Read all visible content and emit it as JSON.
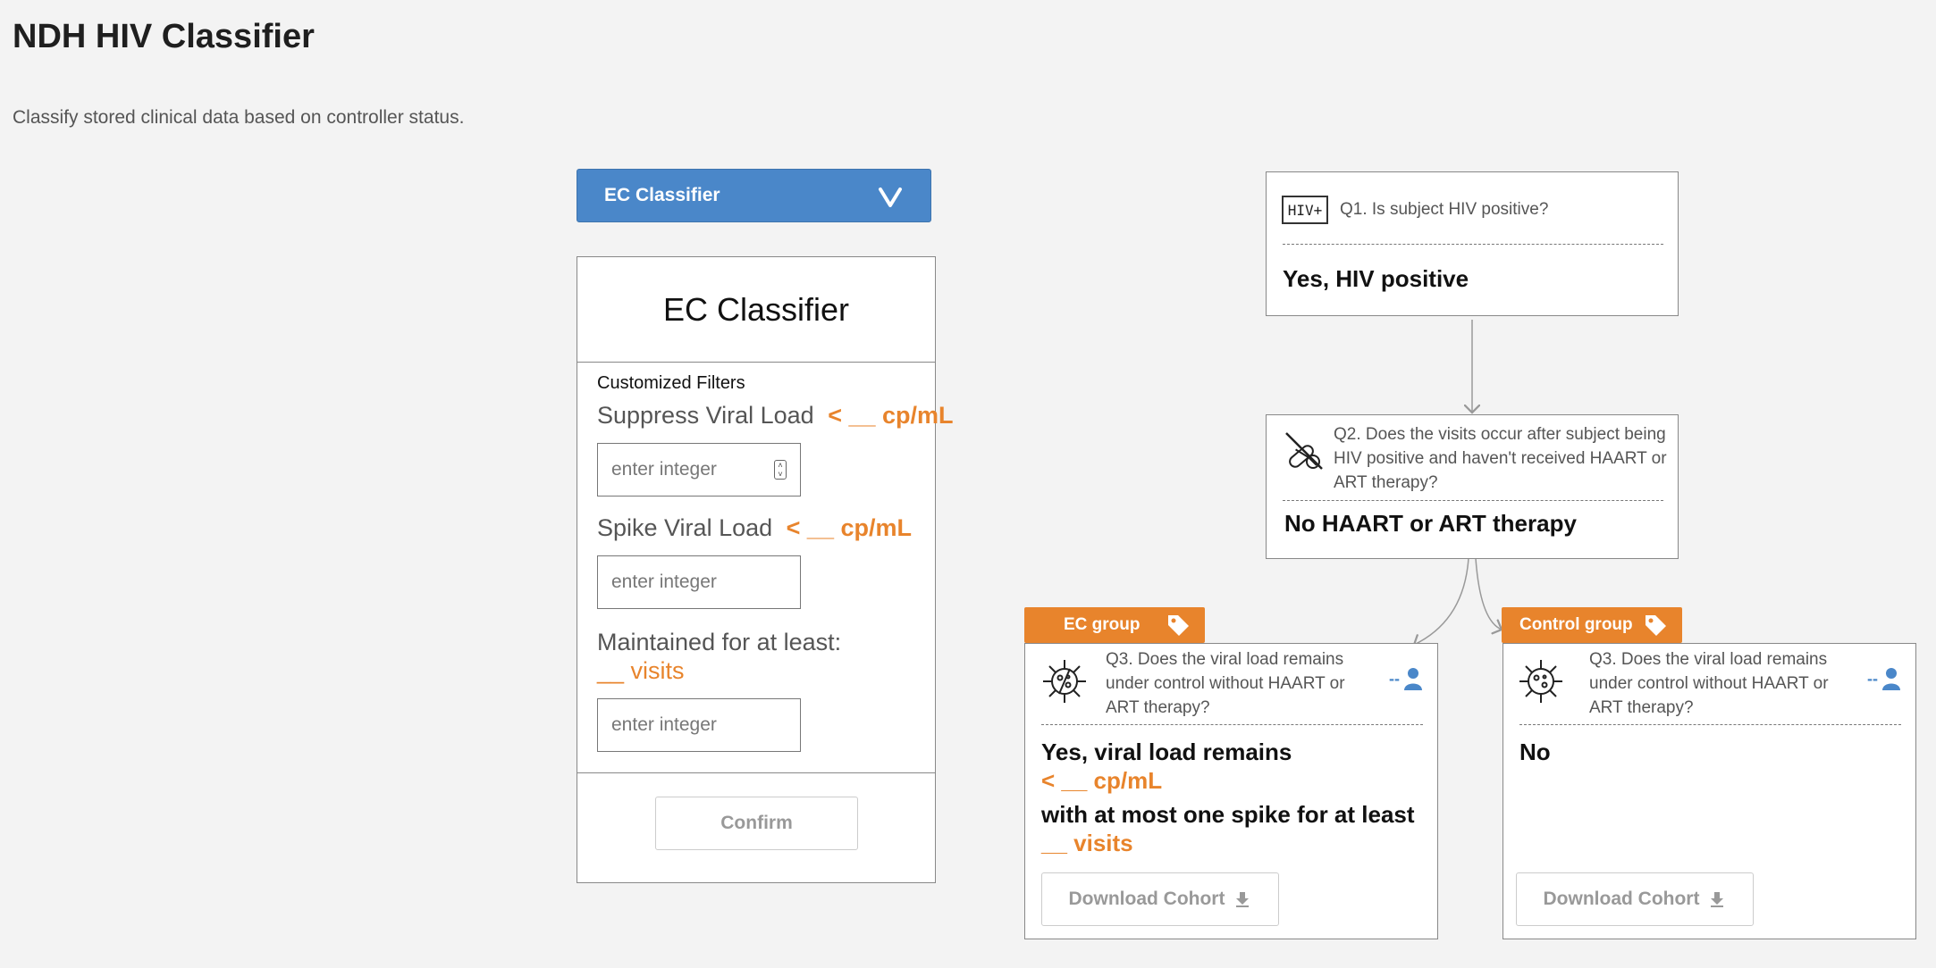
{
  "header": {
    "title": "NDH HIV Classifier",
    "subtitle": "Classify stored clinical data based on controller status."
  },
  "dropdown": {
    "selected": "EC Classifier"
  },
  "panel": {
    "title": "EC Classifier",
    "section_label": "Customized Filters",
    "suppress": {
      "label": "Suppress Viral Load",
      "unit": "< __  cp/mL",
      "placeholder": "enter integer"
    },
    "spike": {
      "label": "Spike Viral Load",
      "unit": "< __  cp/mL",
      "placeholder": "enter integer"
    },
    "maintained": {
      "label": "Maintained for at least:",
      "unit": "__  visits",
      "placeholder": "enter integer"
    },
    "confirm_label": "Confirm"
  },
  "flow": {
    "q1": {
      "badge": "HIV+",
      "question": "Q1. Is subject HIV positive?",
      "answer": "Yes, HIV positive"
    },
    "q2": {
      "question": "Q2. Does the visits occur after subject being HIV positive and haven't received HAART or ART therapy?",
      "answer": "No HAART or ART therapy"
    },
    "ec": {
      "tag": "EC group",
      "question": "Q3. Does the viral load remains under control without HAART or ART therapy?",
      "count": "--",
      "answer_line1": "Yes,  viral load remains",
      "answer_unit1": "< __  cp/mL",
      "answer_line2": "with at most one spike for at least",
      "answer_unit2": "__  visits",
      "download_label": "Download Cohort"
    },
    "control": {
      "tag": "Control group",
      "question": "Q3. Does the viral load remains under control without HAART or ART therapy?",
      "count": "--",
      "answer": "No",
      "download_label": "Download Cohort"
    }
  },
  "colors": {
    "accent_blue": "#4a87c9",
    "accent_orange": "#e8842c",
    "background": "#f3f3f3"
  }
}
